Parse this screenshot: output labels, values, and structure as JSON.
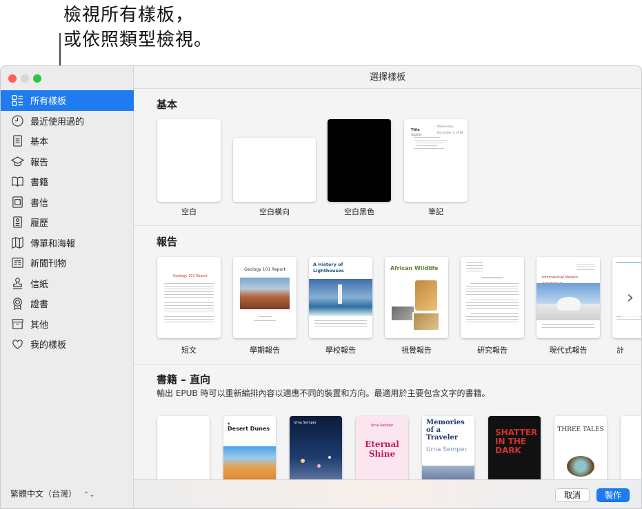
{
  "callout": {
    "line1": "檢視所有樣板，",
    "line2": "或依照類型檢視。"
  },
  "window": {
    "title": "選擇樣板"
  },
  "sidebar": {
    "items": [
      {
        "label": "所有樣板",
        "icon": "all-templates-icon",
        "active": true
      },
      {
        "label": "最近使用過的",
        "icon": "clock-icon"
      },
      {
        "label": "基本",
        "icon": "document-icon"
      },
      {
        "label": "報告",
        "icon": "graduation-cap-icon"
      },
      {
        "label": "書籍",
        "icon": "book-icon"
      },
      {
        "label": "書信",
        "icon": "letter-icon"
      },
      {
        "label": "履歷",
        "icon": "resume-icon"
      },
      {
        "label": "傳單和海報",
        "icon": "map-icon"
      },
      {
        "label": "新聞刊物",
        "icon": "newsletter-icon"
      },
      {
        "label": "信紙",
        "icon": "stamp-icon"
      },
      {
        "label": "證書",
        "icon": "award-icon"
      },
      {
        "label": "其他",
        "icon": "archive-box-icon"
      },
      {
        "label": "我的樣板",
        "icon": "heart-icon"
      }
    ],
    "language": "繁體中文（台灣）"
  },
  "sections": {
    "basic": {
      "title": "基本",
      "templates": [
        {
          "label": "空白"
        },
        {
          "label": "空白橫向"
        },
        {
          "label": "空白黑色"
        },
        {
          "label": "筆記",
          "heading": "Title",
          "date": "Wednesday, December 5, 2018",
          "sub": "Subtitle"
        }
      ]
    },
    "reports": {
      "title": "報告",
      "templates": [
        {
          "label": "短文",
          "heading": "Geology 101 Report"
        },
        {
          "label": "學期報告",
          "heading": "Geology 101 Report"
        },
        {
          "label": "學校報告",
          "heading": "A History of Lighthouses"
        },
        {
          "label": "視覺報告",
          "heading": "African Wildlife"
        },
        {
          "label": "研究報告"
        },
        {
          "label": "現代式報告",
          "heading": "International Modern Architecture"
        },
        {
          "label": "計"
        }
      ]
    },
    "books": {
      "title": "書籍 – 直向",
      "subtitle": "輸出 EPUB 時可以重新編排內容以適應不同的裝置和方向。最適用於主要包含文字的書籍。",
      "templates": [
        {
          "heading": ""
        },
        {
          "heading": "Desert Dunes"
        },
        {
          "heading": "Urna Semper"
        },
        {
          "heading": "Eternal Shine",
          "author": "Urna Semper"
        },
        {
          "heading": "Memories of a Traveler",
          "author": "Urna Semper"
        },
        {
          "heading": "SHATTER IN THE DARK"
        },
        {
          "heading": "THREE TALES"
        }
      ]
    }
  },
  "buttons": {
    "cancel": "取消",
    "create": "製作"
  },
  "colors": {
    "accent": "#1e7bf0",
    "sidebar_bg": "#ececec",
    "main_bg": "#f4f4f4"
  }
}
